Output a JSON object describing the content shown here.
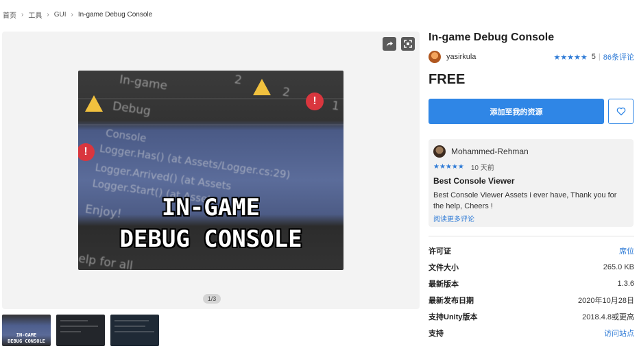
{
  "breadcrumb": [
    {
      "label": "首页"
    },
    {
      "label": "工具"
    },
    {
      "label": "GUI"
    },
    {
      "label": "In-game Debug Console"
    }
  ],
  "gallery": {
    "pager": "1/3",
    "hero_lines": [
      "IN-GAME",
      "DEBUG CONSOLE"
    ],
    "hero_ghost": [
      "In-game",
      "Debug",
      "Console",
      "Logger.Has() (at Assets/Logger.cs:29)",
      "Logger.Arrived() (at Assets",
      "Logger.Start() (at Assets",
      "Enjoy!",
      "elp for all"
    ],
    "hero_counts": [
      "2",
      "2",
      "1"
    ],
    "thumb_titles": [
      "IN-GAME",
      "DEBUG CONSOLE"
    ]
  },
  "product": {
    "title": "In-game Debug Console",
    "author": "yasirkula",
    "stars": "★★★★★",
    "rating": "5",
    "rating_sep": "|",
    "review_count": "86条评论",
    "price": "FREE",
    "add_button": "添加至我的资源"
  },
  "review": {
    "name": "Mohammed-Rehman",
    "stars": "★★★★★",
    "time": "10 天前",
    "title": "Best Console Viewer",
    "body": "Best Console Viewer Assets i ever have, Thank you for the help, Cheers !",
    "more": "阅读更多评论"
  },
  "info": [
    {
      "key": "许可证",
      "value": "席位",
      "link": true
    },
    {
      "key": "文件大小",
      "value": "265.0 KB",
      "link": false
    },
    {
      "key": "最新版本",
      "value": "1.3.6",
      "link": false
    },
    {
      "key": "最新发布日期",
      "value": "2020年10月28日",
      "link": false
    },
    {
      "key": "支持Unity版本",
      "value": "2018.4.8或更高",
      "link": false
    },
    {
      "key": "支持",
      "value": "访问站点",
      "link": true
    }
  ],
  "colors": {
    "accent": "#2f86e6",
    "star": "#2f7bd6"
  },
  "icons": [
    "share-icon",
    "fullscreen-icon",
    "heart-icon",
    "chevron-right-icon"
  ]
}
